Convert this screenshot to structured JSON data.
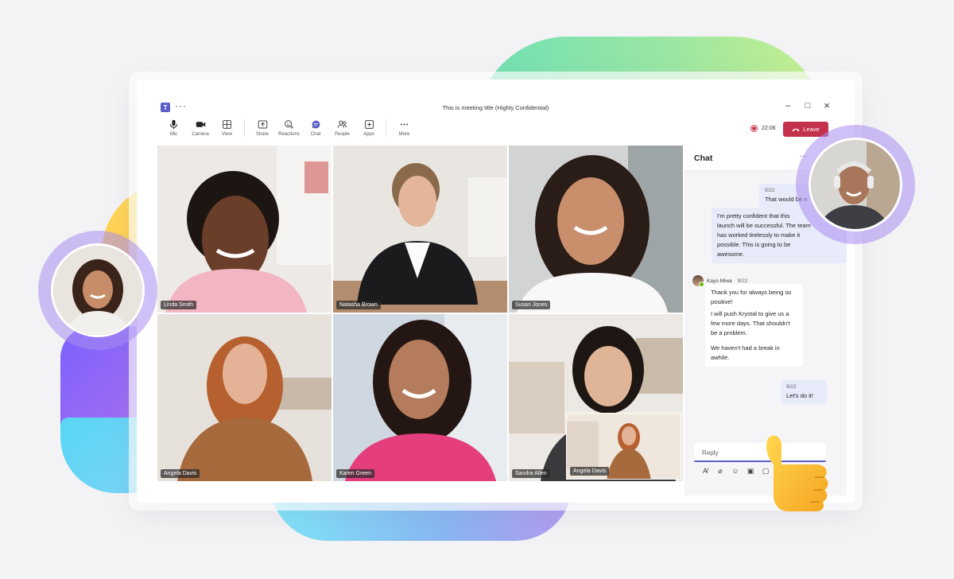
{
  "window": {
    "title": "This is meeting title (Highly Confidential)",
    "more": "···",
    "app_badge": "T"
  },
  "window_controls": {
    "minimize": "–",
    "maximize": "□",
    "close": "×"
  },
  "toolbar": {
    "items": [
      {
        "label": "Mic",
        "icon": "mic-icon"
      },
      {
        "label": "Camera",
        "icon": "camera-icon"
      },
      {
        "label": "View",
        "icon": "grid-icon"
      },
      {
        "label": "Share",
        "icon": "share-icon"
      },
      {
        "label": "Reactions",
        "icon": "reactions-icon"
      },
      {
        "label": "Chat",
        "icon": "chat-icon"
      },
      {
        "label": "People",
        "icon": "people-icon"
      },
      {
        "label": "Apps",
        "icon": "apps-icon"
      },
      {
        "label": "More",
        "icon": "more-icon"
      }
    ]
  },
  "recording": {
    "time": "22:06"
  },
  "leave_button": {
    "label": "Leave"
  },
  "participants": [
    {
      "name": "Linda Smith"
    },
    {
      "name": "Natasha Brown"
    },
    {
      "name": "Susan Jones"
    },
    {
      "name": "Angela Davis"
    },
    {
      "name": "Karen Green"
    },
    {
      "name": "Sandra Allen"
    }
  ],
  "pip": {
    "name": "Angela Davis"
  },
  "chat": {
    "title": "Chat",
    "more": "···",
    "messages": [
      {
        "timestamp": "9/22",
        "text": "That would be n"
      },
      {
        "text_lines": [
          "I'm pretty confident that this",
          "launch will be successful. The team",
          "has worked tirelessly to make it",
          "possible. This is going to be",
          "awesome."
        ]
      },
      {
        "sender": "Kayo Miwa",
        "timestamp": "9/22"
      },
      {
        "text_lines": [
          "Thank you for always being so",
          "positive!"
        ]
      },
      {
        "text_lines": [
          "I will push Krystal to give us a",
          "few more days. That shouldn't",
          "be a problem."
        ]
      },
      {
        "text_lines": [
          "We haven't had a break in",
          "awhile."
        ]
      },
      {
        "timestamp": "9/22",
        "text": "Let's do it!"
      }
    ],
    "reply_placeholder": "Reply"
  },
  "colors": {
    "accent": "#5b5fc7",
    "leave": "#c4314b",
    "bubble_self": "#e8ebfa"
  }
}
